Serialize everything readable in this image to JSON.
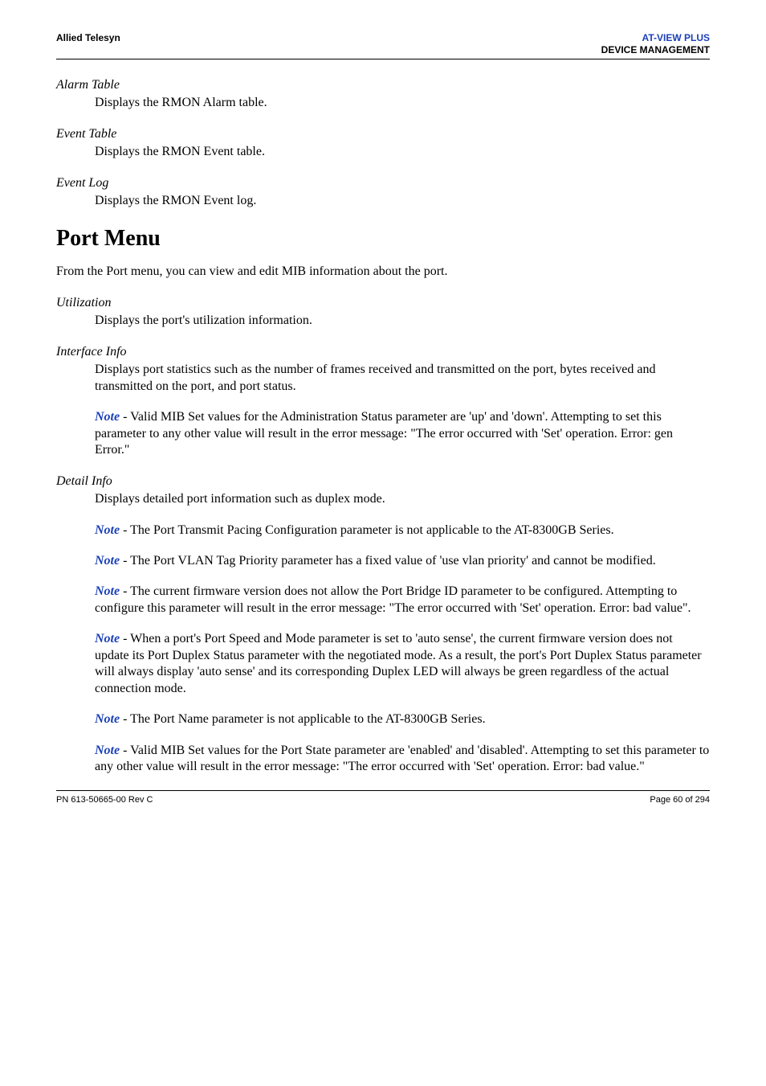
{
  "header": {
    "left": "Allied Telesyn",
    "right_top": "AT-VIEW PLUS",
    "right_bottom": "DEVICE MANAGEMENT"
  },
  "sections": {
    "alarm_table": {
      "title": "Alarm Table",
      "body": "Displays the RMON Alarm table."
    },
    "event_table": {
      "title": "Event Table",
      "body": "Displays the RMON Event table."
    },
    "event_log": {
      "title": "Event Log",
      "body": "Displays the RMON Event log."
    }
  },
  "heading": "Port Menu",
  "intro": "From the Port menu, you can view and edit MIB information about the port.",
  "utilization": {
    "title": "Utilization",
    "body": "Displays the port's utilization information."
  },
  "interface_info": {
    "title": "Interface Info",
    "body": "Displays port statistics such as the number of frames received and transmitted on the port, bytes received and transmitted on the port, and port status.",
    "note1": " - Valid MIB Set values for the Administration Status parameter are 'up' and 'down'. Attempting to set this parameter to any other value will result in the error message: \"The error occurred with 'Set' operation. Error: gen Error.\""
  },
  "detail_info": {
    "title": "Detail Info",
    "body": "Displays detailed port information such as duplex mode.",
    "note1": " - The Port Transmit Pacing Configuration parameter is not applicable to the AT-8300GB Series.",
    "note2": " - The Port VLAN Tag Priority parameter has a fixed value of 'use vlan priority' and cannot be modified.",
    "note3": " - The current firmware version does not allow the Port Bridge ID parameter to be configured. Attempting to configure this parameter will result in the error message: \"The error occurred with 'Set' operation. Error: bad value\".",
    "note4": " - When a port's Port Speed and Mode parameter is set to 'auto sense', the current firmware version does not update its Port Duplex Status parameter with the negotiated mode. As a result, the port's Port Duplex Status parameter will always display 'auto sense' and its corresponding Duplex LED will always be green regardless of the actual connection mode.",
    "note5": " - The Port Name parameter is not applicable to the AT-8300GB Series.",
    "note6": " - Valid MIB Set values for the Port State parameter are 'enabled' and 'disabled'. Attempting to set this parameter to any other value will result in the error message: \"The error occurred with 'Set' operation. Error: bad value.\""
  },
  "note_label": "Note",
  "footer": {
    "left": "PN 613-50665-00 Rev C",
    "right": "Page 60 of 294"
  }
}
